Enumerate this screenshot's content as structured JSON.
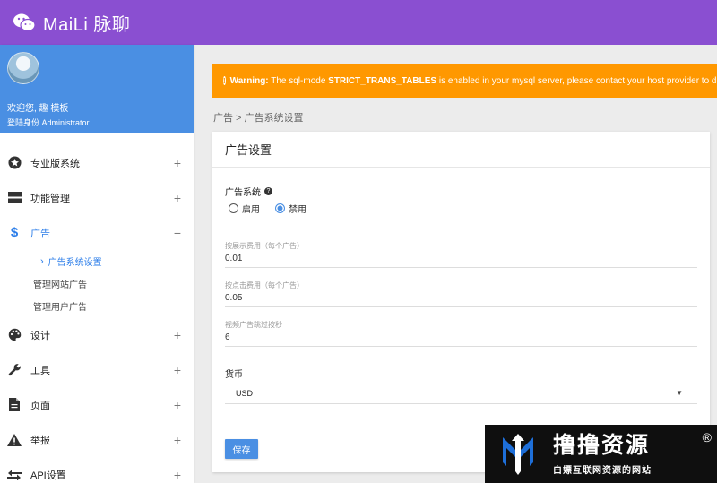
{
  "app": {
    "brand": "MaiLi 脉聊"
  },
  "user": {
    "welcome": "欢迎您, 趣 模板",
    "role": "登陆身份 Administrator"
  },
  "sidebar": {
    "items": [
      {
        "label": "专业版系统",
        "icon": "star-badge-icon",
        "toggle": "+"
      },
      {
        "label": "功能管理",
        "icon": "server-icon",
        "toggle": "+"
      },
      {
        "label": "广告",
        "icon": "dollar-icon",
        "toggle": "−",
        "expanded": true,
        "children": [
          {
            "label": "广告系统设置",
            "current": true
          },
          {
            "label": "管理网站广告"
          },
          {
            "label": "管理用户广告"
          }
        ]
      },
      {
        "label": "设计",
        "icon": "palette-icon",
        "toggle": "+"
      },
      {
        "label": "工具",
        "icon": "wrench-icon",
        "toggle": "+"
      },
      {
        "label": "页面",
        "icon": "file-icon",
        "toggle": "+"
      },
      {
        "label": "举报",
        "icon": "warning-icon",
        "toggle": "+"
      },
      {
        "label": "API设置",
        "icon": "swap-arrows-icon",
        "toggle": "+"
      }
    ]
  },
  "warning": {
    "prefix": "Warning:",
    "text1": " The sql-mode ",
    "code": "STRICT_TRANS_TABLES",
    "text2": " is enabled in your mysql server, please contact your host provider to di"
  },
  "breadcrumb": "广告 > 广告系统设置",
  "form": {
    "title": "广告设置",
    "ad_system": {
      "label": "广告系统",
      "options": [
        {
          "label": "启用",
          "selected": false
        },
        {
          "label": "禁用",
          "selected": true
        }
      ]
    },
    "view_cost": {
      "label": "按展示费用（每个广告）",
      "value": "0.01"
    },
    "click_cost": {
      "label": "按点击费用（每个广告）",
      "value": "0.05"
    },
    "video_skip": {
      "label": "视频广告跳过按秒",
      "value": "6"
    },
    "currency": {
      "label": "货币",
      "value": "USD"
    },
    "save_label": "保存"
  },
  "watermark": {
    "title": "撸撸资源",
    "subtitle": "白嫖互联网资源的网站",
    "reg": "®"
  },
  "colors": {
    "topbar": "#8a4fd1",
    "profile": "#4a8fe3",
    "warning": "#ff9800",
    "accent": "#2b7de9"
  }
}
